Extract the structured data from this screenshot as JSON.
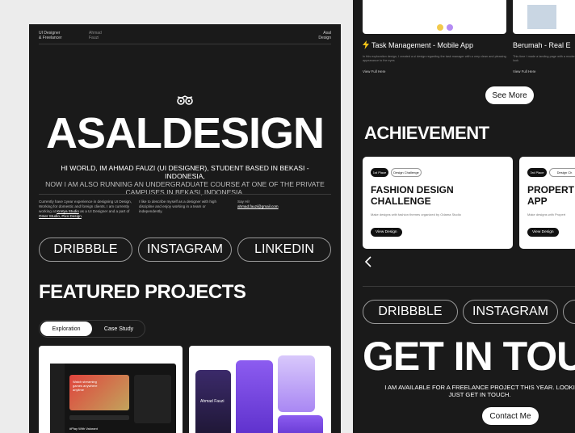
{
  "left": {
    "topbar": {
      "role_line1": "UI Designer",
      "role_line2": "& Freelancer",
      "name_line1": "Ahmad",
      "name_line2": "Fauzi",
      "ask_line1": "Asal",
      "ask_line2": "Design"
    },
    "hero_title": "ASALDESIGN",
    "intro_line1": "HI WORLD, IM AHMAD FAUZI (UI DESIGNER), STUDENT BASED IN BEKASI - INDONESIA,",
    "intro_line2": "NOW I AM ALSO RUNNING AN UNDERGRADUATE COURSE AT ONE OF THE PRIVATE",
    "intro_line3": "CAMPUSES IN BEKASI, INDONESIA.",
    "col1_text": "Currently have 1year experience in designing UI Design, Working for domestic and foreign clients. I am currently working at ",
    "col1_link1": "Kretya Studio",
    "col1_mid": " as a UI Designer and a part of ",
    "col1_link2": "Omer Studio, Pixo Design",
    "col1_end": ".",
    "col2_text": "I like to describe myself as a designer with high discipline and enjoy working in a team or independently.",
    "col3_label": "Say Hi!",
    "col3_email": "ahmad.fauzi@gmail.com",
    "social": [
      "DRIBBBLE",
      "INSTAGRAM",
      "LINKEDIN"
    ],
    "featured_title": "FEATURED PROJECTS",
    "tabs": [
      "Exploration",
      "Case Study"
    ],
    "card1": {
      "headline": "Watch streaming games anywhere anytime",
      "caption": "#Play With Valorant"
    },
    "card2": {
      "name": "Ahmad Fauzi"
    }
  },
  "right": {
    "projects": [
      {
        "title": "Task Management - Mobile App",
        "desc": "In this exploration design, I created a ui design regarding the task manager with a very clean and pleasing appearance to the eyes",
        "link": "View Full Here"
      },
      {
        "title": "Berumah - Real E",
        "desc": "This time I made a landing page with a modern look",
        "link": "View Full Here"
      }
    ],
    "see_more": "See More",
    "achievement_title": "ACHIEVEMENT",
    "achievements": [
      {
        "place": "1st Place",
        "category": "Design Challenge",
        "title_line1": "FASHION DESIGN",
        "title_line2": "CHALLENGE",
        "desc": "Make designs with fashion themes organized by Odama Studio",
        "cta": "View Design"
      },
      {
        "place": "3rd Place",
        "category": "Design Ch",
        "title_line1": "PROPERT",
        "title_line2": "APP",
        "desc": "Make designs with Propert",
        "cta": "View Design"
      }
    ],
    "social": [
      "DRIBBBLE",
      "INSTAGRAM"
    ],
    "get_in_touch": "GET IN TOU",
    "available_line1": "I AM AVAILABLE FOR A FREELANCE PROJECT THIS YEAR. LOOKI",
    "available_line2": "JUST GET IN TOUCH.",
    "contact": "Contact Me"
  }
}
